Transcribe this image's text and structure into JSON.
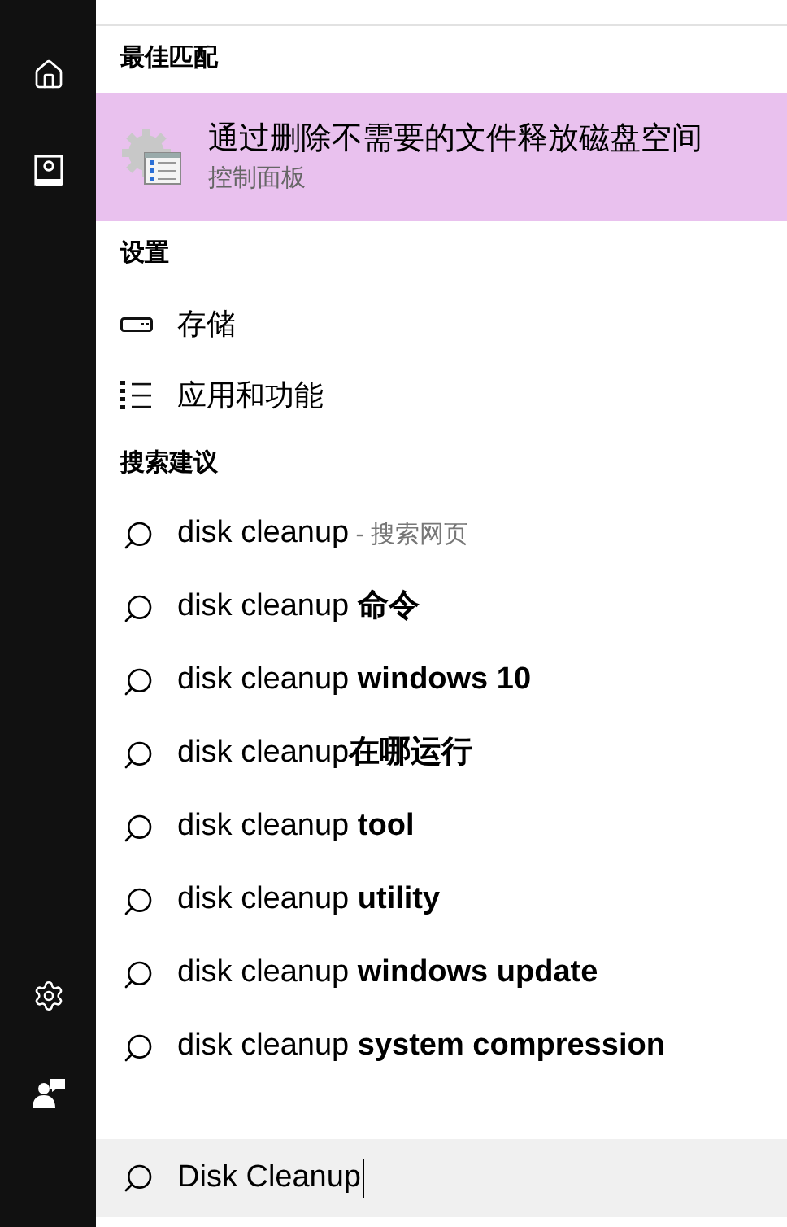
{
  "best_match": {
    "heading": "最佳匹配",
    "title": "通过删除不需要的文件释放磁盘空间",
    "subtitle": "控制面板",
    "selected": true
  },
  "settings": {
    "heading": "设置",
    "items": [
      {
        "kind": "storage",
        "label": "存储"
      },
      {
        "kind": "apps",
        "label": "应用和功能"
      }
    ]
  },
  "suggestions": {
    "heading": "搜索建议",
    "items": [
      {
        "text": "disk cleanup",
        "note": "- 搜索网页"
      },
      {
        "text": "disk cleanup **命令**"
      },
      {
        "text": "disk cleanup **windows 10**"
      },
      {
        "text": "disk cleanup**在哪运行**"
      },
      {
        "text": "disk cleanup **tool**"
      },
      {
        "text": "disk cleanup **utility**"
      },
      {
        "text": "disk cleanup **windows update**"
      },
      {
        "text": "disk cleanup **system compression**"
      }
    ]
  },
  "search": {
    "value": "Disk Cleanup"
  }
}
